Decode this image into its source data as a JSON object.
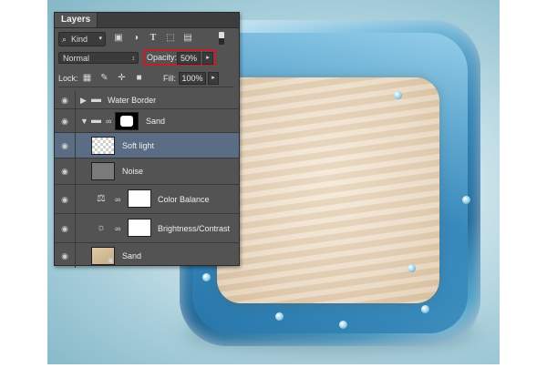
{
  "panel": {
    "tab_label": "Layers",
    "filter": {
      "label": "Kind"
    },
    "filter_icons": [
      "image-filter-icon",
      "adjustment-filter-icon",
      "type-filter-icon",
      "shape-filter-icon",
      "smart-object-filter-icon",
      "filter-toggle-icon"
    ],
    "blend_mode": "Normal",
    "opacity": {
      "label": "Opacity:",
      "value": "50%"
    },
    "lock": {
      "label": "Lock:",
      "icons": [
        "lock-transparent-icon",
        "lock-image-icon",
        "lock-position-icon",
        "lock-all-icon"
      ]
    },
    "fill": {
      "label": "Fill:",
      "value": "100%"
    }
  },
  "layers": [
    {
      "name": "Water Border",
      "type": "group",
      "expanded": false,
      "selected": false
    },
    {
      "name": "Sand",
      "type": "group",
      "expanded": true,
      "selected": false
    },
    {
      "name": "Soft light",
      "type": "layer",
      "selected": true
    },
    {
      "name": "Noise",
      "type": "layer",
      "selected": false
    },
    {
      "name": "Color Balance",
      "type": "adjustment",
      "selected": false
    },
    {
      "name": "Brightness/Contrast",
      "type": "adjustment",
      "selected": false
    },
    {
      "name": "Sand",
      "type": "smart-object",
      "selected": false
    }
  ],
  "colors": {
    "panel_bg": "#535353",
    "selected_row": "#5b6d84",
    "highlight_border": "#c21e2c",
    "canvas_bg": "#a9cfdb"
  }
}
